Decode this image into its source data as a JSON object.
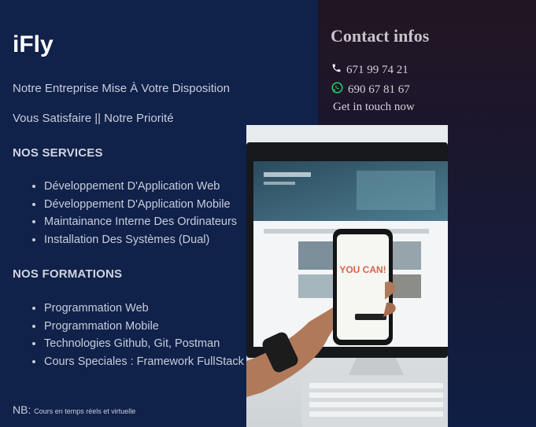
{
  "brand": "iFly",
  "tagline1": "Notre Entreprise Mise À Votre Disposition",
  "tagline2": "Vous Satisfaire || Notre Priorité",
  "services": {
    "title": "NOS SERVICES",
    "items": [
      "Développement D'Application Web",
      "Développement D'Application Mobile",
      "Maintainance Interne Des Ordinateurs",
      "Installation Des Systèmes (Dual)"
    ]
  },
  "formations": {
    "title": "NOS FORMATIONS",
    "items": [
      "Programmation Web",
      "Programmation Mobile",
      "Technologies Github, Git, Postman",
      "Cours Speciales : Framework FullStack"
    ]
  },
  "nb": {
    "label": "NB:",
    "text": "Cours en temps réels et virtuelle"
  },
  "contact": {
    "title": "Contact infos",
    "phone": "671 99 74 21",
    "whatsapp": "690 67 81 67",
    "cta": "Get in touch now"
  },
  "photo": {
    "phone_screen_text": "YOU CAN!"
  },
  "colors": {
    "left_bg": "#10214a",
    "right_bg": "#221522",
    "whatsapp": "#25d366"
  }
}
